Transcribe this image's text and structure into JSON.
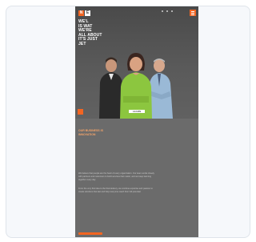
{
  "logo": {
    "mark": "N",
    "name": "E"
  },
  "hero": {
    "headline": "WE'L\nIS WAT\nWE'RE\nALL ABOUT\nIT'S JUST\nJET",
    "cta_label": "LEARN",
    "icons": {
      "menu": "hamburger-icon",
      "play": "play-icon"
    }
  },
  "section": {
    "title": "OUR BUSINESS IS\nINNOVATION"
  },
  "paragraphs": [
    "We believe that people are the heart of every organization. Our team works closely with partners and customers to build services that matter, and we keep learning together every day.",
    "From the very first idea to the final delivery, we combine expertise and passion to create solutions that last and help everyone reach their full potential."
  ],
  "colors": {
    "accent": "#f26522",
    "background": "#6b6b6b",
    "hero_background": "#4a4a4a",
    "card_background": "#f6f8fb"
  }
}
